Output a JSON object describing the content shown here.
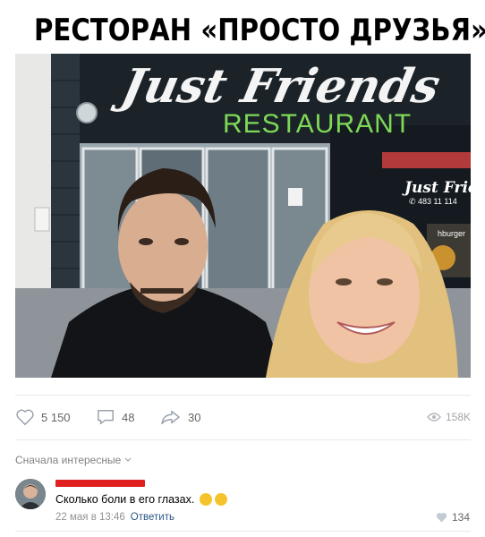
{
  "post": {
    "title": "РЕСТОРАН «ПРОСТО ДРУЗЬЯ»",
    "photo": {
      "sign_script": "Just Friends",
      "sign_subtitle": "RESTAURANT",
      "window_logo": "Just Frien",
      "window_phone": "✆ 483 11 114",
      "window_burger": "hburger"
    },
    "actions": {
      "likes": "5 150",
      "comments": "48",
      "shares": "30",
      "views": "158K"
    }
  },
  "comments": {
    "sort_label": "Сначала интересные",
    "items": [
      {
        "text": "Сколько боли в его глазах.",
        "emoji": [
          "face-with-tears-of-joy",
          "weary-face"
        ],
        "date": "22 мая в 13:46",
        "reply_label": "Ответить",
        "likes": "134"
      }
    ]
  },
  "colors": {
    "muted_text": "#828282",
    "link": "#2a5885",
    "divider": "#e7e8ec",
    "redaction": "#e02020",
    "sign_green": "#7ed957"
  }
}
